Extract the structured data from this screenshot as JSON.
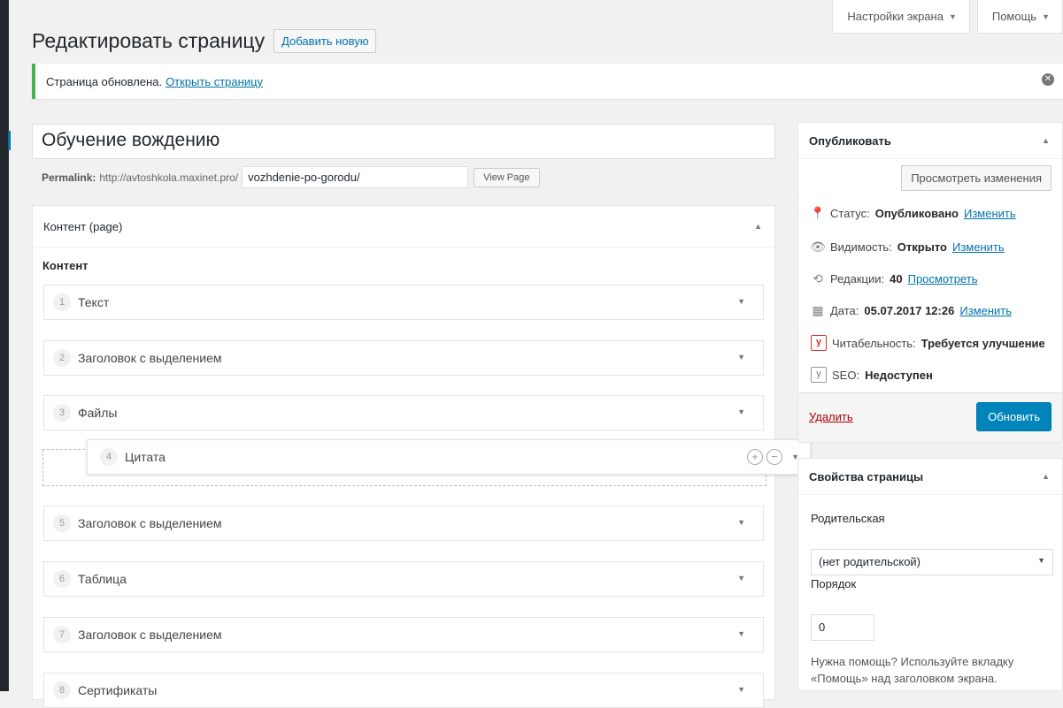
{
  "screen_tabs": {
    "options": "Настройки экрана",
    "help": "Помощь"
  },
  "header": {
    "title": "Редактировать страницу",
    "add_new": "Добавить новую"
  },
  "notice": {
    "text": "Страница обновлена.",
    "link": "Открыть страницу"
  },
  "editor": {
    "title": "Обучение вождению",
    "permalink_label": "Permalink:",
    "permalink_base": "http://avtoshkola.maxinet.pro/",
    "slug": "vozhdenie-po-gorodu/",
    "view_page": "View Page"
  },
  "content_box": {
    "title": "Контент (page)",
    "field_label": "Контент",
    "rows": [
      {
        "num": "1",
        "title": "Текст"
      },
      {
        "num": "2",
        "title": "Заголовок с выделением"
      },
      {
        "num": "3",
        "title": "Файлы"
      },
      {
        "num": "4",
        "title": "Цитата"
      },
      {
        "num": "5",
        "title": "Заголовок с выделением"
      },
      {
        "num": "6",
        "title": "Таблица"
      },
      {
        "num": "7",
        "title": "Заголовок с выделением"
      },
      {
        "num": "8",
        "title": "Сертификаты"
      }
    ]
  },
  "publish": {
    "title": "Опубликовать",
    "preview": "Просмотреть изменения",
    "status_label": "Статус:",
    "status_value": "Опубликовано",
    "status_link": "Изменить",
    "visibility_label": "Видимость:",
    "visibility_value": "Открыто",
    "visibility_link": "Изменить",
    "revisions_label": "Редакции:",
    "revisions_value": "40",
    "revisions_link": "Просмотреть",
    "date_label": "Дата:",
    "date_value": "05.07.2017 12:26",
    "date_link": "Изменить",
    "readability_label": "Читабельность:",
    "readability_value": "Требуется улучшение",
    "seo_label": "SEO:",
    "seo_value": "Недоступен",
    "delete": "Удалить",
    "update": "Обновить"
  },
  "page_attributes": {
    "title": "Свойства страницы",
    "parent_label": "Родительская",
    "parent_value": "(нет родительской)",
    "order_label": "Порядок",
    "order_value": "0",
    "help": "Нужна помощь? Используйте вкладку «Помощь» над заголовком экрана."
  },
  "colors": {
    "accent": "#0085ba",
    "notice_border": "#46b450",
    "link": "#0073aa",
    "danger": "#a00"
  }
}
